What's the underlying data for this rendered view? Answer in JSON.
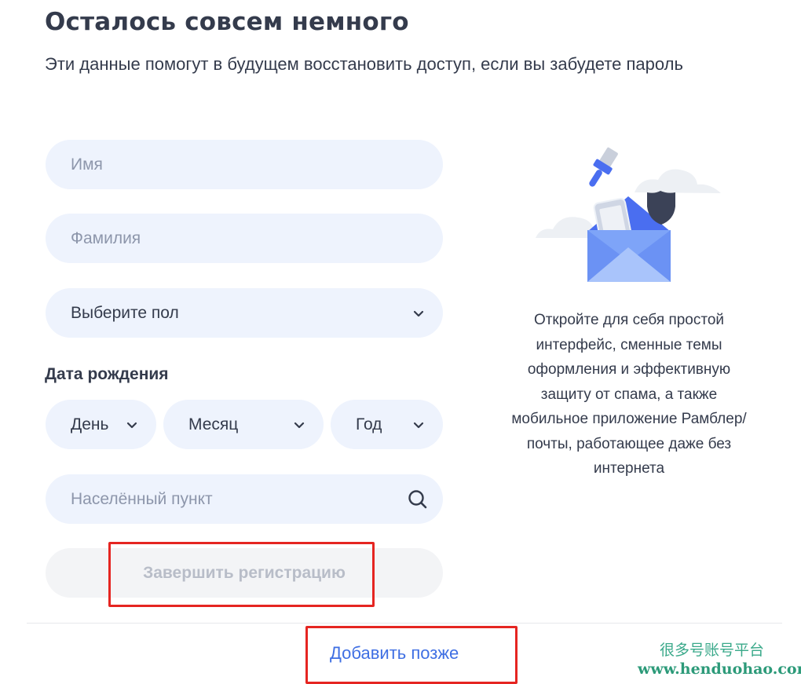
{
  "header": {
    "title": "Осталось совсем немного",
    "subtitle": "Эти данные помогут в будущем восстановить доступ, если вы забудете пароль"
  },
  "form": {
    "first_name": {
      "placeholder": "Имя",
      "value": ""
    },
    "last_name": {
      "placeholder": "Фамилия",
      "value": ""
    },
    "gender": {
      "selected": "Выберите пол"
    },
    "birth_date": {
      "label": "Дата рождения",
      "day": "День",
      "month": "Месяц",
      "year": "Год"
    },
    "city": {
      "placeholder": "Населённый пункт",
      "value": ""
    },
    "submit_label": "Завершить регистрацию"
  },
  "footer": {
    "add_later": "Добавить позже"
  },
  "promo": {
    "text": "Откройте для себя простой интерфейс, сменные темы оформления и эффективную защиту от спама, а также мобильное приложение Рамблер/почты, работающее даже без интернета"
  },
  "watermark": {
    "line1": "很多号账号平台",
    "line2": "www.henduohao.com"
  },
  "colors": {
    "field_bg": "#eef3fd",
    "text": "#343b4c",
    "placeholder": "#8d96ab",
    "link": "#3f6fe3",
    "highlight": "#e52521",
    "submit_disabled_bg": "#f3f4f6",
    "submit_disabled_text": "#b8bdc8"
  },
  "icons": [
    "chevron-down-icon",
    "search-icon",
    "envelope-illustration"
  ]
}
